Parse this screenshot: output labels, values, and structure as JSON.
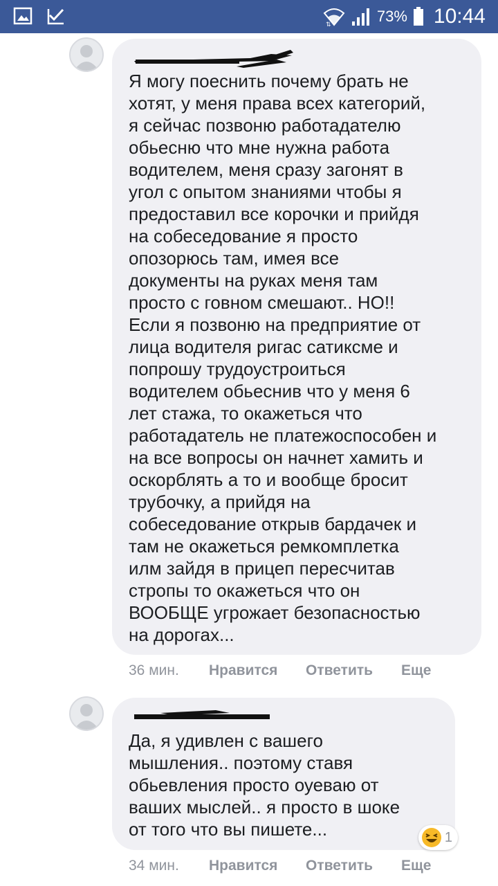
{
  "status_bar": {
    "battery_percent": "73%",
    "time": "10:44"
  },
  "comments": [
    {
      "text": "Я могу поеснить почему брать не\nхотят, у меня права всех категорий,\nя сейчас позвоню работадателю\nобьесню что мне нужна работа\nводителем, меня сразу загонят в\nугол с опытом знаниями чтобы я\nпредоставил все корочки и прийдя\nна собеседование я просто\nопозорюсь там, имея все\nдокументы на руках меня там\nпросто с говном смешают.. НО!!\nЕсли я позвоню на предприятие от\nлица водителя ригас сатиксме и\nпопрошу трудоустроиться\nводителем обьеснив что у меня 6\nлет стажа, то окажеться что\nработадатель не платежоспособен и\nна все вопросы он начнет хамить и\nоскорблять а то и вообще бросит\nтрубочку, а прийдя на\nсобеседование открыв бардачек и\nтам не окажеться ремкомплетка\nилм зайдя в прицеп пересчитав\nстропы то окажеться что он\nВООБЩЕ угрожает безопасностью\nна дорогах...",
      "time": "36 мин.",
      "like": "Нравится",
      "reply": "Ответить",
      "more": "Еще"
    },
    {
      "text": "Да, я удивлен с вашего\nмышления.. поэтому ставя\nобьевления просто оуеваю от\nваших мыслей.. я просто в шоке\nот того что вы пишете...",
      "time": "34 мин.",
      "like": "Нравится",
      "reply": "Ответить",
      "more": "Еще",
      "reaction": {
        "icon": "laughing-emoji-icon",
        "count": "1"
      }
    }
  ]
}
